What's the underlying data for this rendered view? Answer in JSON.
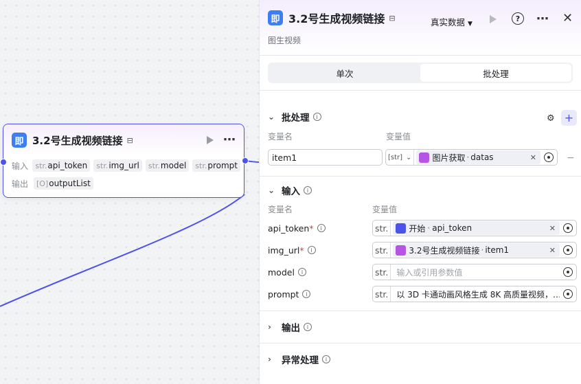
{
  "node": {
    "icon_text": "即",
    "title": "3.2号生成视频链接",
    "input_label": "输入",
    "output_label": "输出",
    "inputs": [
      {
        "type": "str.",
        "name": "api_token"
      },
      {
        "type": "str.",
        "name": "img_url"
      },
      {
        "type": "str.",
        "name": "model"
      },
      {
        "type": "str.",
        "name": "prompt"
      }
    ],
    "outputs": [
      {
        "type": "[O]",
        "name": "outputList"
      }
    ]
  },
  "panel": {
    "icon_text": "即",
    "title": "3.2号生成视频链接",
    "subtitle": "图生视频",
    "mode_label": "真实数据",
    "tabs": [
      {
        "label": "单次",
        "active": false
      },
      {
        "label": "批处理",
        "active": true
      }
    ],
    "batch": {
      "title": "批处理",
      "col_name": "变量名",
      "col_value": "变量值",
      "row": {
        "name": "item1",
        "type": "[str]",
        "ref_source": "图片获取",
        "ref_field": "datas"
      }
    },
    "input": {
      "title": "输入",
      "col_name": "变量名",
      "col_value": "变量值",
      "params": [
        {
          "name": "api_token",
          "required": true,
          "type": "str.",
          "kind": "ref",
          "ref_source": "开始",
          "ref_field": "api_token",
          "icon": "blue"
        },
        {
          "name": "img_url",
          "required": true,
          "type": "str.",
          "kind": "ref",
          "ref_source": "3.2号生成视频链接",
          "ref_field": "item1",
          "icon": "purple"
        },
        {
          "name": "model",
          "required": false,
          "type": "str.",
          "kind": "placeholder",
          "text": "输入或引用参数值"
        },
        {
          "name": "prompt",
          "required": false,
          "type": "str.",
          "kind": "value",
          "text": "以 3D 卡通动画风格生成 8K 高质量视频，…"
        }
      ]
    },
    "output_title": "输出",
    "exception_title": "异常处理"
  },
  "colors": {
    "accent": "#4d53e8",
    "node_icon": "#3d7ff3",
    "ref_icon_purple": "#b554e5"
  }
}
